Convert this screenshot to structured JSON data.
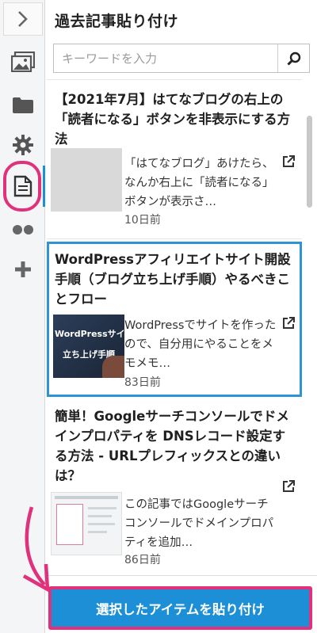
{
  "panel": {
    "title": "過去記事貼り付け",
    "search_placeholder": "キーワードを入力",
    "paste_button_label": "選択したアイテムを貼り付け"
  },
  "rail": {
    "items": [
      {
        "icon": "chevron-right-icon"
      },
      {
        "icon": "image-icon"
      },
      {
        "icon": "folder-icon"
      },
      {
        "icon": "gear-icon"
      },
      {
        "icon": "document-icon",
        "active": true
      },
      {
        "icon": "dots-icon"
      },
      {
        "icon": "plus-icon"
      }
    ]
  },
  "articles": [
    {
      "title": "【2021年7月】はてなブログの右上の「読者になる」ボタンを非表示にする方法",
      "excerpt": "「はてなブログ」あけたら、なんか右上に「読者になる」ボタンが表示さ…",
      "date": "10日前",
      "selected": false,
      "thumb": "gray"
    },
    {
      "title": "WordPressアフィリエイトサイト開設手順（ブログ立ち上げ手順）やるべきことフロー",
      "excerpt": "WordPressでサイトを作ったので、自分用にやることをメモメモ…",
      "date": "83日前",
      "selected": true,
      "thumb": "dark",
      "thumb_text": [
        "WordPressサイ",
        "立ち上げ手順"
      ]
    },
    {
      "title": "簡単！Googleサーチコンソールでドメインプロパティを DNSレコード設定する方法 - URLプレフィックスとの違いは？",
      "excerpt": "この記事ではGoogleサーチコンソールでドメインプロパティを追加…",
      "date": "86日前",
      "selected": false,
      "thumb": "screenshot"
    }
  ],
  "colors": {
    "accent": "#1d8fd6",
    "highlight": "#e0317c"
  }
}
